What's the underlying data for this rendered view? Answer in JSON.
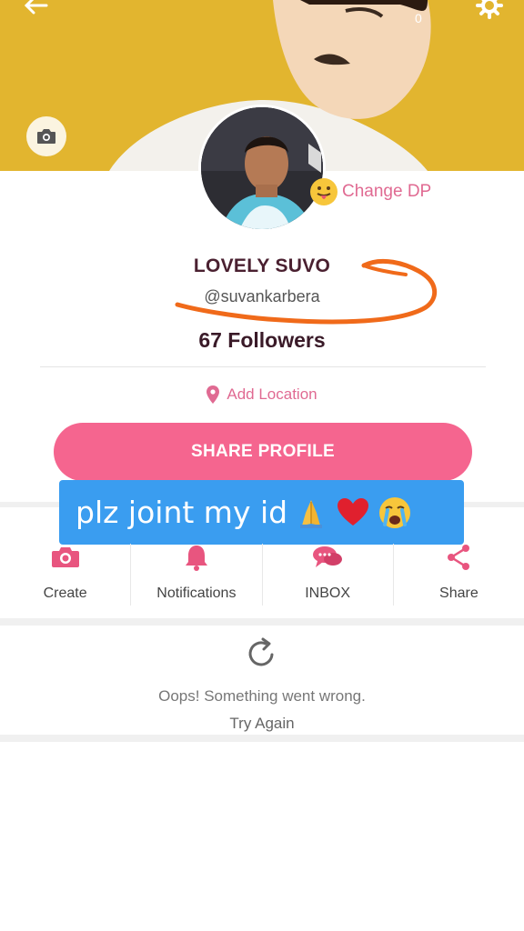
{
  "cover": {
    "coin_count": "0"
  },
  "profile": {
    "change_dp_label": "Change DP",
    "name": "LOVELY SUVO",
    "handle": "@suvankarbera",
    "followers": "67 Followers",
    "location_label": "Add Location",
    "share_profile_label": "SHARE PROFILE"
  },
  "caption": {
    "text": "plz joint my id"
  },
  "actions": [
    {
      "label": "Create",
      "icon": "camera-icon"
    },
    {
      "label": "Notifications",
      "icon": "bell-icon"
    },
    {
      "label": "INBOX",
      "icon": "chat-icon"
    },
    {
      "label": "Share",
      "icon": "share-icon"
    }
  ],
  "error": {
    "message": "Oops! Something went wrong.",
    "retry_label": "Try Again"
  },
  "colors": {
    "accent": "#f5658f",
    "cover_bg": "#e2b52f",
    "caption_bg": "#3a9df0",
    "annotation": "#f06a1a"
  }
}
